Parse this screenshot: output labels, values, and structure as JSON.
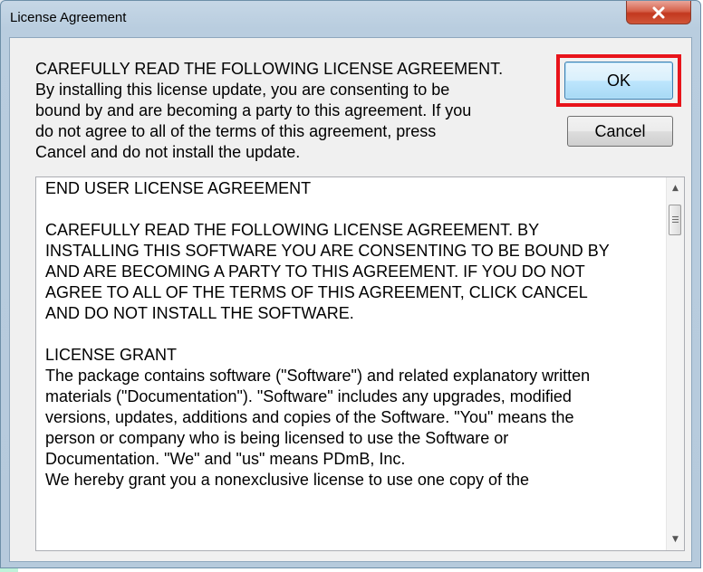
{
  "window": {
    "title": "License Agreement",
    "close_glyph": "✕"
  },
  "message": {
    "lines": [
      "CAREFULLY READ THE FOLLOWING LICENSE AGREEMENT.",
      "By installing this license update, you are consenting to be",
      "bound by and are becoming a party to this agreement. If you",
      "do not agree to all of the terms of this agreement, press",
      "Cancel and do not install the update."
    ]
  },
  "buttons": {
    "ok_label": "OK",
    "cancel_label": "Cancel"
  },
  "license": {
    "lines": [
      "END USER LICENSE AGREEMENT",
      "",
      "CAREFULLY READ THE FOLLOWING LICENSE AGREEMENT. BY",
      "INSTALLING THIS SOFTWARE YOU ARE CONSENTING TO BE BOUND BY",
      "AND ARE BECOMING A PARTY TO THIS AGREEMENT. IF YOU DO NOT",
      "AGREE TO ALL OF THE TERMS OF THIS AGREEMENT, CLICK CANCEL",
      "AND DO NOT INSTALL THE SOFTWARE.",
      "",
      "LICENSE GRANT",
      "The package contains software (\"Software\") and related explanatory written",
      "materials (\"Documentation\"). \"Software\" includes any upgrades, modified",
      "versions, updates, additions and copies of the Software. \"You\" means the",
      "person or company who is being licensed to use the Software or",
      "Documentation. \"We\" and \"us\" means PDmB, Inc.",
      "We hereby grant you a nonexclusive license to use one copy of the"
    ]
  },
  "scrollbar": {
    "up_arrow": "▲",
    "down_arrow": "▼"
  },
  "colors": {
    "highlight": "#e8141b"
  }
}
